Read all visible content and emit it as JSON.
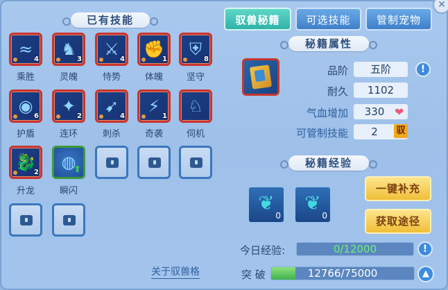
{
  "left_panel": {
    "title": "已有技能",
    "skills": [
      {
        "label": "乘胜",
        "badge": "4",
        "glyph": "≈",
        "icon": "wave-icon"
      },
      {
        "label": "灵魄",
        "badge": "3",
        "glyph": "♞",
        "icon": "spirit-icon"
      },
      {
        "label": "恃势",
        "badge": "4",
        "glyph": "⚔",
        "icon": "swords-icon"
      },
      {
        "label": "体魄",
        "badge": "1",
        "glyph": "✊",
        "icon": "fist-icon"
      },
      {
        "label": "坚守",
        "badge": "8",
        "glyph": "⛨",
        "icon": "shield-icon"
      },
      {
        "label": "护盾",
        "badge": "6",
        "glyph": "◉",
        "icon": "orb-shield-icon"
      },
      {
        "label": "连环",
        "badge": "2",
        "glyph": "✦",
        "icon": "crystal-icon"
      },
      {
        "label": "刺杀",
        "badge": "4",
        "glyph": "➹",
        "icon": "dash-icon"
      },
      {
        "label": "奇袭",
        "badge": "1",
        "glyph": "⚡",
        "icon": "lightning-icon"
      },
      {
        "label": "伺机",
        "badge": "",
        "glyph": "♘",
        "icon": "beast-icon"
      },
      {
        "label": "升龙",
        "badge": "2",
        "glyph": "🐉",
        "icon": "dragon-icon"
      },
      {
        "label": "瞬闪",
        "badge": "",
        "glyph": "◍",
        "icon": "blink-icon"
      }
    ],
    "about_link": "关于驭兽格"
  },
  "tabs": [
    "驭兽秘籍",
    "可选技能",
    "管制宠物"
  ],
  "attributes": {
    "title": "秘籍属性",
    "grade_label": "品阶",
    "grade_value": "五阶",
    "durability_label": "耐久",
    "durability_value": "1102",
    "hp_label": "气血增加",
    "hp_value": "330",
    "controllable_label": "可管制技能",
    "controllable_value": "2",
    "pet_tag": "驭"
  },
  "experience": {
    "title": "秘籍经验",
    "items": [
      {
        "count": "0",
        "icon": "beast-spirit-icon"
      },
      {
        "count": "0",
        "icon": "beast-spirit-icon"
      }
    ],
    "refill_button": "一键补充",
    "obtain_button": "获取途径",
    "today_label": "今日经验:",
    "today_value": "0/12000",
    "today_fraction": 0,
    "breakthrough_label": "突 破",
    "breakthrough_value": "12766/75000",
    "breakthrough_fraction": 0.17
  },
  "colors": {
    "accent_tab": "#2fb3a8",
    "owned_border": "#c9342d",
    "gold_button": "#f0bf38"
  }
}
